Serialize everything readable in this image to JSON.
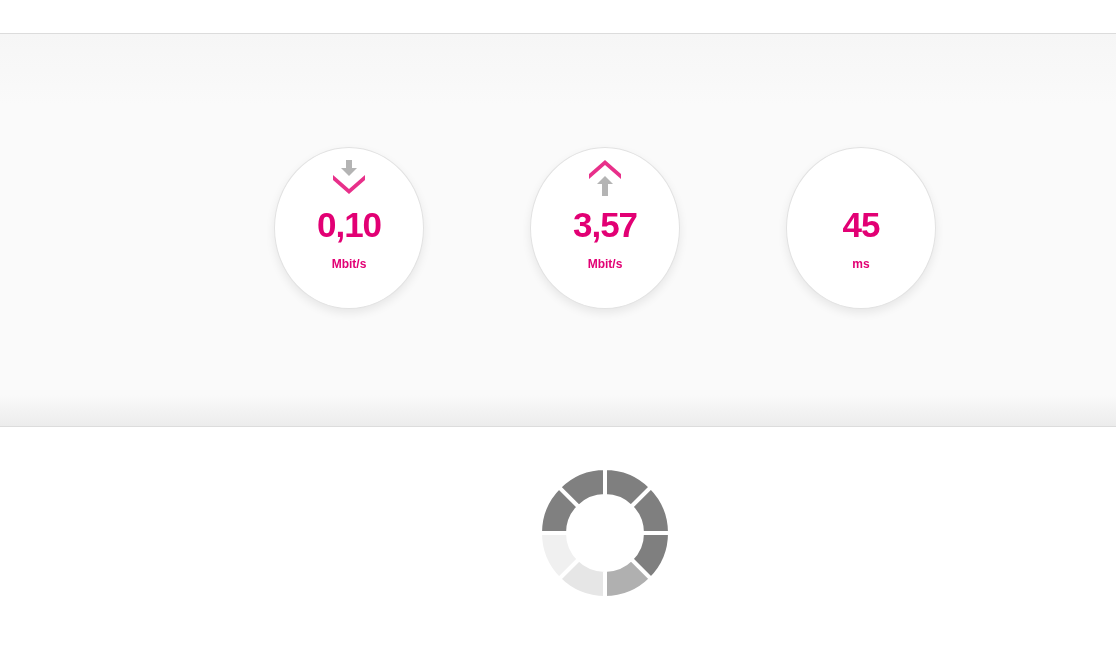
{
  "results": [
    {
      "kind": "download",
      "value": "0,10",
      "unit": "Mbit/s"
    },
    {
      "kind": "upload",
      "value": "3,57",
      "unit": "Mbit/s"
    },
    {
      "kind": "ping",
      "value": "45",
      "unit": "ms"
    }
  ]
}
